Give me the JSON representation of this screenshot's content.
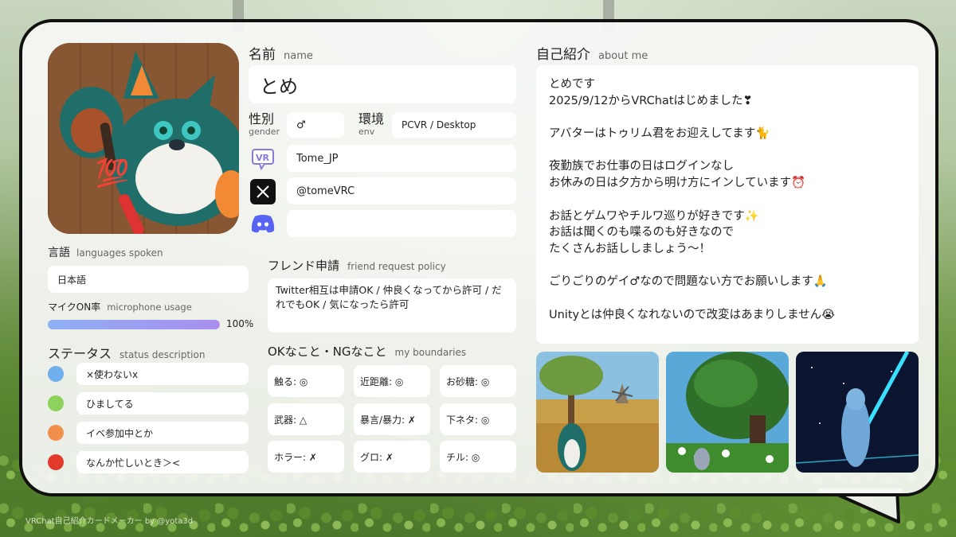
{
  "name": {
    "label_jp": "名前",
    "label_en": "name",
    "value": "とめ"
  },
  "gender": {
    "label_jp": "性別",
    "label_en": "gender",
    "value": "♂"
  },
  "env": {
    "label_jp": "環境",
    "label_en": "env",
    "value": "PCVR / Desktop"
  },
  "socials": {
    "vrchat": {
      "icon": "vrchat-icon",
      "value": "Tome_JP"
    },
    "x": {
      "icon": "x-icon",
      "value": "@tomeVRC"
    },
    "discord": {
      "icon": "discord-icon",
      "value": ""
    }
  },
  "languages": {
    "label_jp": "言語",
    "label_en": "languages spoken",
    "value": "日本語"
  },
  "mic": {
    "label_jp": "マイクON率",
    "label_en": "microphone usage",
    "percent_text": "100%",
    "percent": 100
  },
  "status": {
    "label_jp": "ステータス",
    "label_en": "status description",
    "items": [
      {
        "color": "#6fb0ec",
        "text": "×使わないx"
      },
      {
        "color": "#8ed25c",
        "text": "ひましてる"
      },
      {
        "color": "#f18f4d",
        "text": "イベ参加中とか"
      },
      {
        "color": "#e23b2c",
        "text": "なんか忙しいとき＞<"
      }
    ]
  },
  "friend_request": {
    "label_jp": "フレンド申請",
    "label_en": "friend request policy",
    "text": "Twitter相互は申請OK / 仲良くなってから許可 / だれでもOK / 気になったら許可"
  },
  "boundaries": {
    "label_jp": "OKなこと・NGなこと",
    "label_en": "my boundaries",
    "items": [
      "触る: ◎",
      "近距離: ◎",
      "お砂糖: ◎",
      "武器: △",
      "暴言/暴力: ✗",
      "下ネタ: ◎",
      "ホラー: ✗",
      "グロ: ✗",
      "チル: ◎"
    ]
  },
  "about": {
    "label_jp": "自己紹介",
    "label_en": "about me",
    "lines": [
      "とめです",
      "2025/9/12からVRChatはじめました❣",
      "",
      "アバターはトゥリム君をお迎えしてます🐈",
      "",
      "夜勤族でお仕事の日はログインなし",
      "お休みの日は夕方から明け方にインしています⏰",
      "",
      "お話とゲムワやチルワ巡りが好きです✨",
      "お話は聞くのも喋るのも好きなので",
      "たくさんお話ししましょう〜！",
      "",
      "ごりごりのゲイ♂なので問題ない方でお願いします🙏",
      "",
      "Unityとは仲良くなれないので改変はあまりしません😭"
    ]
  },
  "footer": "VRChat自己紹介カードメーカー by @yota3d"
}
